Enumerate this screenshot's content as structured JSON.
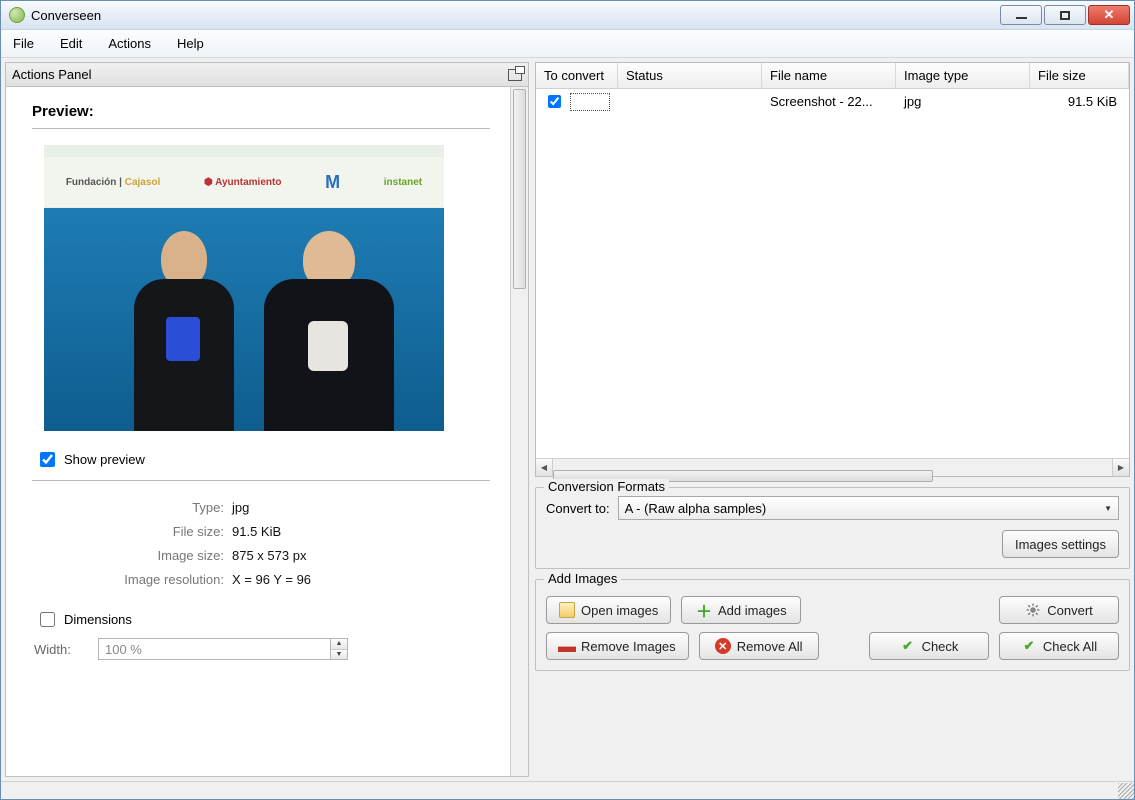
{
  "app": {
    "title": "Converseen"
  },
  "menus": {
    "file": "File",
    "edit": "Edit",
    "actions": "Actions",
    "help": "Help"
  },
  "left": {
    "panel_title": "Actions Panel",
    "preview_label": "Preview:",
    "show_preview_label": "Show preview",
    "show_preview_checked": true,
    "meta": {
      "type_label": "Type:",
      "type_value": "jpg",
      "file_size_label": "File size:",
      "file_size_value": "91.5 KiB",
      "image_size_label": "Image size:",
      "image_size_value": "875 x 573 px",
      "image_res_label": "Image resolution:",
      "image_res_value": "X = 96 Y = 96"
    },
    "dimensions_label": "Dimensions",
    "dimensions_checked": false,
    "width_label": "Width:",
    "width_value": "100 %"
  },
  "table": {
    "headers": {
      "to_convert": "To convert",
      "status": "Status",
      "file_name": "File name",
      "image_type": "Image type",
      "file_size": "File size"
    },
    "rows": [
      {
        "checked": true,
        "status": "",
        "file_name": "Screenshot - 22...",
        "image_type": "jpg",
        "file_size": "91.5 KiB"
      }
    ]
  },
  "conversion": {
    "group_label": "Conversion Formats",
    "convert_to_label": "Convert to:",
    "selected": "A - (Raw alpha samples)",
    "images_settings_btn": "Images settings"
  },
  "add": {
    "group_label": "Add Images",
    "open_images": "Open images",
    "add_images": "Add images",
    "convert": "Convert",
    "remove_images": "Remove Images",
    "remove_all": "Remove All",
    "check": "Check",
    "check_all": "Check All"
  }
}
